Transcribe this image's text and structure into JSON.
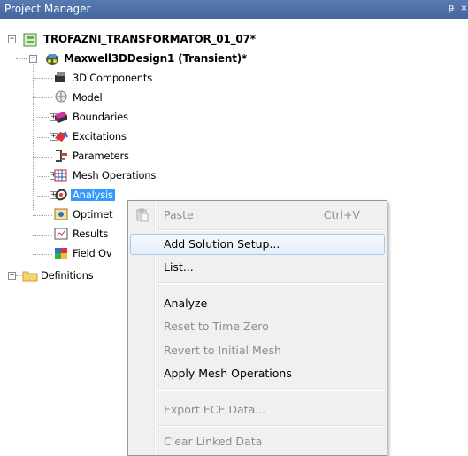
{
  "panel": {
    "title": "Project Manager",
    "pin_glyph": "ᵽ",
    "close_glyph": "×"
  },
  "tree": {
    "project": "TROFAZNI_TRANSFORMATOR_01_07*",
    "design": "Maxwell3DDesign1 (Transient)*",
    "items": [
      {
        "label": "3D Components",
        "icon": "3d-components-icon"
      },
      {
        "label": "Model",
        "icon": "model-icon"
      },
      {
        "label": "Boundaries",
        "icon": "boundaries-icon"
      },
      {
        "label": "Excitations",
        "icon": "excitations-icon"
      },
      {
        "label": "Parameters",
        "icon": "parameters-icon"
      },
      {
        "label": "Mesh Operations",
        "icon": "mesh-operations-icon"
      },
      {
        "label": "Analysis",
        "icon": "analysis-icon"
      },
      {
        "label": "Optimet",
        "icon": "optimetrics-icon"
      },
      {
        "label": "Results",
        "icon": "results-icon"
      },
      {
        "label": "Field Ov",
        "icon": "field-overlays-icon"
      }
    ],
    "definitions": "Definitions"
  },
  "context_menu": {
    "paste": "Paste",
    "paste_shortcut": "Ctrl+V",
    "add_solution_setup": "Add Solution Setup...",
    "list": "List...",
    "analyze": "Analyze",
    "reset_time_zero": "Reset to Time Zero",
    "revert_initial_mesh": "Revert to Initial Mesh",
    "apply_mesh_operations": "Apply Mesh Operations",
    "export_ece": "Export ECE Data...",
    "clear_linked": "Clear Linked Data"
  },
  "colors": {
    "titlebar": "#40659f",
    "selection": "#3399ff",
    "menu_bg": "#f0f0f0",
    "disabled_text": "#8d8d8d"
  }
}
